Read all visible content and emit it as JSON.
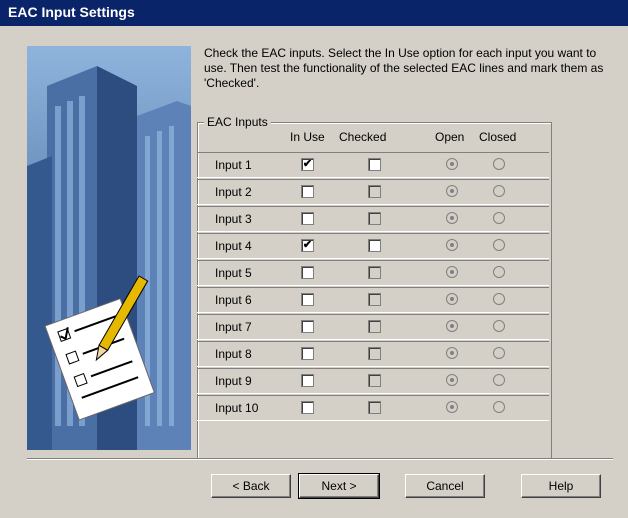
{
  "window": {
    "title": "EAC Input Settings"
  },
  "instructions": "Check the EAC inputs. Select the In Use option for each input you want to use. Then test the functionality of the selected EAC lines and mark them as 'Checked'.",
  "group": {
    "label": "EAC Inputs",
    "columns": {
      "in_use": "In Use",
      "checked": "Checked",
      "open": "Open",
      "closed": "Closed"
    }
  },
  "inputs": [
    {
      "label": "Input 1",
      "in_use": true
    },
    {
      "label": "Input 2",
      "in_use": false
    },
    {
      "label": "Input 3",
      "in_use": false
    },
    {
      "label": "Input 4",
      "in_use": true
    },
    {
      "label": "Input 5",
      "in_use": false
    },
    {
      "label": "Input 6",
      "in_use": false
    },
    {
      "label": "Input 7",
      "in_use": false
    },
    {
      "label": "Input 8",
      "in_use": false
    },
    {
      "label": "Input 9",
      "in_use": false
    },
    {
      "label": "Input 10",
      "in_use": false
    }
  ],
  "buttons": {
    "back": "< Back",
    "next": "Next >",
    "cancel": "Cancel",
    "help": "Help"
  },
  "colors": {
    "titlebar": "#0a246a",
    "face": "#d4d0c8"
  }
}
